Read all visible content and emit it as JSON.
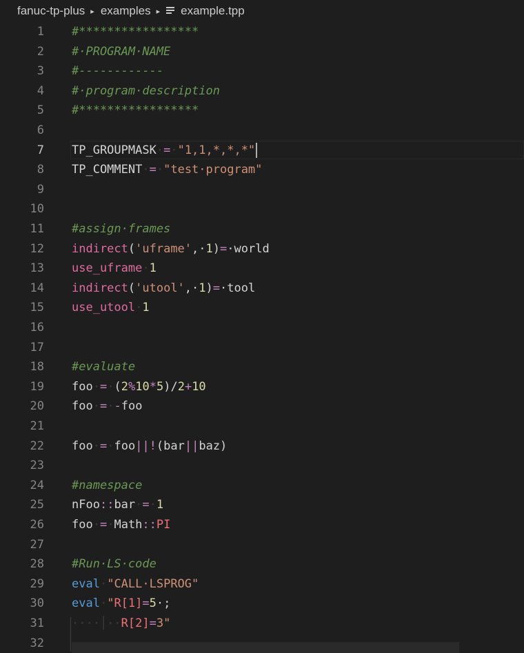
{
  "breadcrumb": {
    "folder1": "fanuc-tp-plus",
    "folder2": "examples",
    "file": "example.tpp"
  },
  "editor": {
    "active_line": 7,
    "lines": [
      {
        "num": "1",
        "tokens": [
          {
            "t": "#*****************",
            "c": "c"
          }
        ]
      },
      {
        "num": "2",
        "tokens": [
          {
            "t": "#·PROGRAM·NAME",
            "c": "c"
          }
        ]
      },
      {
        "num": "3",
        "tokens": [
          {
            "t": "#------------",
            "c": "c"
          }
        ]
      },
      {
        "num": "4",
        "tokens": [
          {
            "t": "#·program·description",
            "c": "c"
          }
        ]
      },
      {
        "num": "5",
        "tokens": [
          {
            "t": "#*****************",
            "c": "c"
          }
        ]
      },
      {
        "num": "6",
        "tokens": []
      },
      {
        "num": "7",
        "tokens": [
          {
            "t": "TP_GROUPMASK",
            "c": "id"
          },
          {
            "t": "·",
            "c": "ws"
          },
          {
            "t": "=",
            "c": "op"
          },
          {
            "t": "·",
            "c": "ws"
          },
          {
            "t": "\"1,1,*,*,*\"",
            "c": "s"
          }
        ]
      },
      {
        "num": "8",
        "tokens": [
          {
            "t": "TP_COMMENT",
            "c": "id"
          },
          {
            "t": "·",
            "c": "ws"
          },
          {
            "t": "=",
            "c": "op"
          },
          {
            "t": "·",
            "c": "ws"
          },
          {
            "t": "\"test·program\"",
            "c": "s"
          }
        ]
      },
      {
        "num": "9",
        "tokens": []
      },
      {
        "num": "10",
        "tokens": []
      },
      {
        "num": "11",
        "tokens": [
          {
            "t": "#assign·frames",
            "c": "c"
          }
        ]
      },
      {
        "num": "12",
        "tokens": [
          {
            "t": "indirect",
            "c": "k"
          },
          {
            "t": "(",
            "c": "id"
          },
          {
            "t": "'uframe'",
            "c": "s"
          },
          {
            "t": ",·",
            "c": "id"
          },
          {
            "t": "1",
            "c": "n"
          },
          {
            "t": ")",
            "c": "id"
          },
          {
            "t": "=",
            "c": "op"
          },
          {
            "t": "·world",
            "c": "id"
          }
        ]
      },
      {
        "num": "13",
        "tokens": [
          {
            "t": "use_uframe",
            "c": "k"
          },
          {
            "t": "·",
            "c": "ws"
          },
          {
            "t": "1",
            "c": "n"
          }
        ]
      },
      {
        "num": "14",
        "tokens": [
          {
            "t": "indirect",
            "c": "k"
          },
          {
            "t": "(",
            "c": "id"
          },
          {
            "t": "'utool'",
            "c": "s"
          },
          {
            "t": ",·",
            "c": "id"
          },
          {
            "t": "1",
            "c": "n"
          },
          {
            "t": ")",
            "c": "id"
          },
          {
            "t": "=",
            "c": "op"
          },
          {
            "t": "·tool",
            "c": "id"
          }
        ]
      },
      {
        "num": "15",
        "tokens": [
          {
            "t": "use_utool",
            "c": "k"
          },
          {
            "t": "·",
            "c": "ws"
          },
          {
            "t": "1",
            "c": "n"
          }
        ]
      },
      {
        "num": "16",
        "tokens": []
      },
      {
        "num": "17",
        "tokens": []
      },
      {
        "num": "18",
        "tokens": [
          {
            "t": "#evaluate",
            "c": "c"
          }
        ]
      },
      {
        "num": "19",
        "tokens": [
          {
            "t": "foo",
            "c": "id"
          },
          {
            "t": "·",
            "c": "ws"
          },
          {
            "t": "=",
            "c": "op"
          },
          {
            "t": "·",
            "c": "ws"
          },
          {
            "t": "(",
            "c": "id"
          },
          {
            "t": "2",
            "c": "n"
          },
          {
            "t": "%",
            "c": "op"
          },
          {
            "t": "10",
            "c": "n"
          },
          {
            "t": "*",
            "c": "op"
          },
          {
            "t": "5",
            "c": "n"
          },
          {
            "t": ")/",
            "c": "id"
          },
          {
            "t": "2",
            "c": "n"
          },
          {
            "t": "+",
            "c": "op"
          },
          {
            "t": "10",
            "c": "n"
          }
        ]
      },
      {
        "num": "20",
        "tokens": [
          {
            "t": "foo",
            "c": "id"
          },
          {
            "t": "·",
            "c": "ws"
          },
          {
            "t": "=",
            "c": "op"
          },
          {
            "t": "·",
            "c": "ws"
          },
          {
            "t": "-",
            "c": "op"
          },
          {
            "t": "foo",
            "c": "id"
          }
        ]
      },
      {
        "num": "21",
        "tokens": []
      },
      {
        "num": "22",
        "tokens": [
          {
            "t": "foo",
            "c": "id"
          },
          {
            "t": "·",
            "c": "ws"
          },
          {
            "t": "=",
            "c": "op"
          },
          {
            "t": "·",
            "c": "ws"
          },
          {
            "t": "foo",
            "c": "id"
          },
          {
            "t": "||!",
            "c": "op"
          },
          {
            "t": "(bar",
            "c": "id"
          },
          {
            "t": "||",
            "c": "op"
          },
          {
            "t": "baz)",
            "c": "id"
          }
        ]
      },
      {
        "num": "23",
        "tokens": []
      },
      {
        "num": "24",
        "tokens": [
          {
            "t": "#namespace",
            "c": "c"
          }
        ]
      },
      {
        "num": "25",
        "tokens": [
          {
            "t": "nFoo",
            "c": "id"
          },
          {
            "t": "::",
            "c": "op"
          },
          {
            "t": "bar",
            "c": "id"
          },
          {
            "t": "·",
            "c": "ws"
          },
          {
            "t": "=",
            "c": "op"
          },
          {
            "t": "·",
            "c": "ws"
          },
          {
            "t": "1",
            "c": "n"
          }
        ]
      },
      {
        "num": "26",
        "tokens": [
          {
            "t": "foo",
            "c": "id"
          },
          {
            "t": "·",
            "c": "ws"
          },
          {
            "t": "=",
            "c": "op"
          },
          {
            "t": "·",
            "c": "ws"
          },
          {
            "t": "Math",
            "c": "id"
          },
          {
            "t": "::",
            "c": "op"
          },
          {
            "t": "PI",
            "c": "rg"
          }
        ]
      },
      {
        "num": "27",
        "tokens": []
      },
      {
        "num": "28",
        "tokens": [
          {
            "t": "#Run·LS·code",
            "c": "c"
          }
        ]
      },
      {
        "num": "29",
        "tokens": [
          {
            "t": "eval",
            "c": "ev"
          },
          {
            "t": "·",
            "c": "ws"
          },
          {
            "t": "\"CALL·LSPROG\"",
            "c": "s"
          }
        ]
      },
      {
        "num": "30",
        "tokens": [
          {
            "t": "eval",
            "c": "ev"
          },
          {
            "t": "·",
            "c": "ws"
          },
          {
            "t": "\"",
            "c": "s"
          },
          {
            "t": "R[1]",
            "c": "rg"
          },
          {
            "t": "=",
            "c": "op"
          },
          {
            "t": "5",
            "c": "n"
          },
          {
            "t": "·;",
            "c": "id"
          }
        ]
      },
      {
        "num": "31",
        "tokens": [
          {
            "t": "····│··",
            "c": "ws"
          },
          {
            "t": "R[2]",
            "c": "rg"
          },
          {
            "t": "=",
            "c": "op"
          },
          {
            "t": "3\"",
            "c": "s"
          }
        ]
      },
      {
        "num": "32",
        "tokens": []
      }
    ]
  },
  "colors": {
    "background": "#1e1e1e",
    "comment": "#6a9955",
    "string": "#ce9178",
    "number": "#dcdcaa",
    "keyword": "#e06c9f",
    "operator": "#c586c0",
    "eval": "#569cd6"
  }
}
